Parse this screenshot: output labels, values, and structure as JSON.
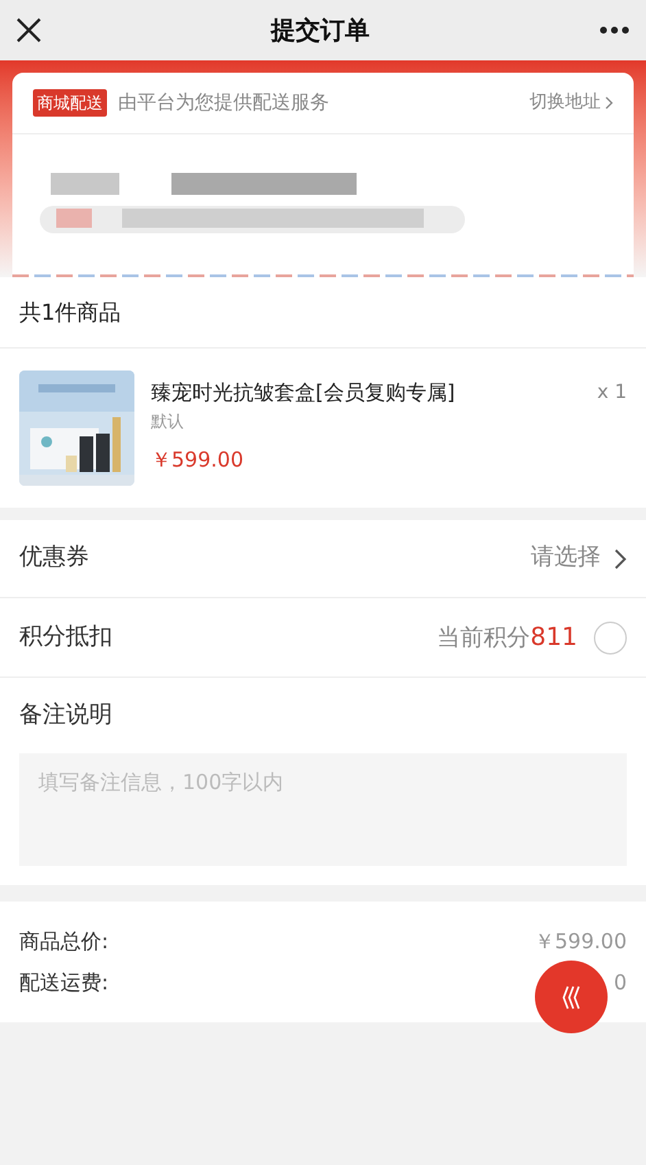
{
  "header": {
    "title": "提交订单"
  },
  "delivery": {
    "badge": "商城配送",
    "note": "由平台为您提供配送服务",
    "switch": "切换地址"
  },
  "goods": {
    "heading": "共1件商品",
    "items": [
      {
        "name": "臻宠时光抗皱套盒[会员复购专属]",
        "spec": "默认",
        "price": "￥599.00",
        "qty": "x 1"
      }
    ]
  },
  "coupon": {
    "label": "优惠券",
    "value": "请选择"
  },
  "points": {
    "label": "积分抵扣",
    "prefix": "当前积分",
    "amount": "811",
    "checked": false
  },
  "remark": {
    "label": "备注说明",
    "placeholder": "填写备注信息，100字以内"
  },
  "totals": [
    {
      "label": "商品总价:",
      "value": "￥599.00"
    },
    {
      "label": "配送运费:",
      "value": "0"
    }
  ]
}
